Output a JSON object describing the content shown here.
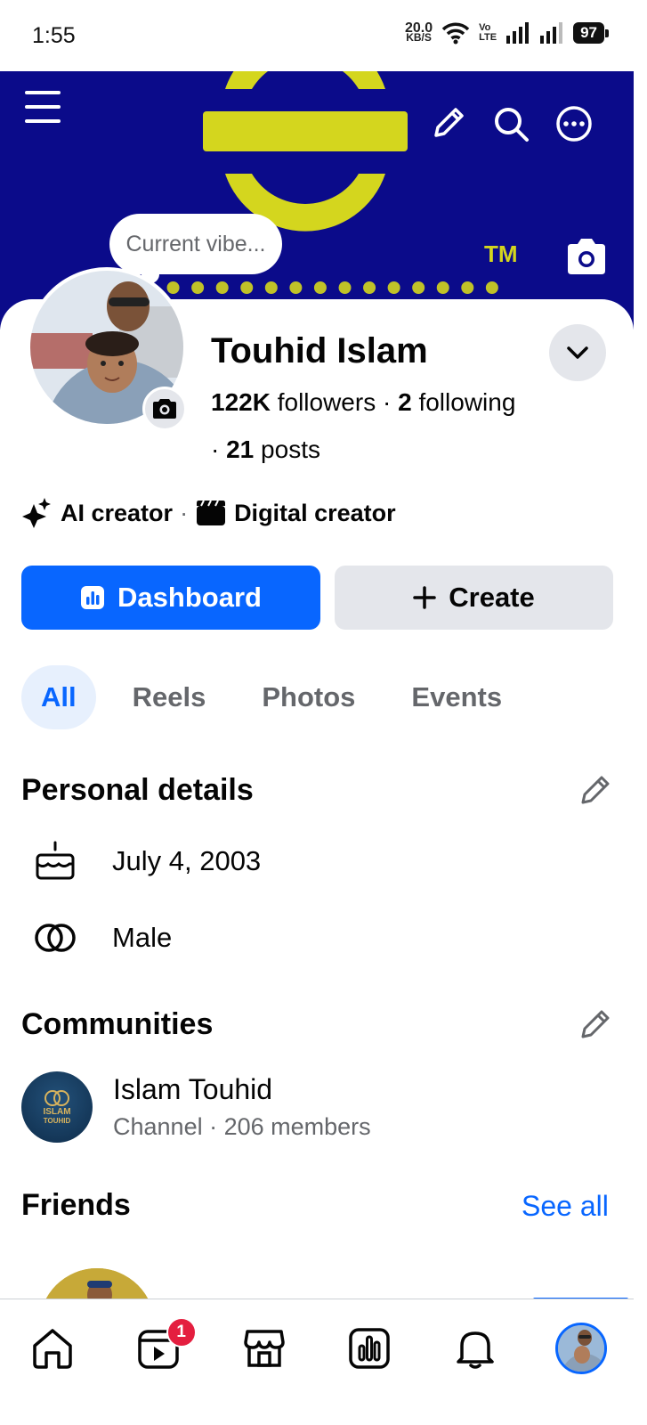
{
  "status_bar": {
    "time": "1:55",
    "net_speed_value": "20.0",
    "net_speed_unit": "KB/S",
    "volte_top": "Vo",
    "volte_bottom": "LTE",
    "battery": "97"
  },
  "cover": {
    "tm_mark": "TM"
  },
  "current_vibe": "Current vibe...",
  "profile": {
    "name": "Touhid Islam",
    "followers_count": "122K",
    "followers_label": "followers",
    "following_count": "2",
    "following_label": "following",
    "posts_count": "21",
    "posts_label": "posts"
  },
  "creator_tags": [
    "AI creator",
    "Digital creator"
  ],
  "actions": {
    "dashboard_label": "Dashboard",
    "create_label": "Create"
  },
  "tabs": [
    {
      "label": "All",
      "active": true
    },
    {
      "label": "Reels",
      "active": false
    },
    {
      "label": "Photos",
      "active": false
    },
    {
      "label": "Events",
      "active": false
    }
  ],
  "personal_details": {
    "title": "Personal details",
    "birthday": "July 4, 2003",
    "gender": "Male"
  },
  "communities": {
    "title": "Communities",
    "items": [
      {
        "name": "Islam Touhid",
        "meta": "Channel · 206 members",
        "logo_text_1": "ISLAM",
        "logo_text_2": "TOUHID"
      }
    ]
  },
  "friends": {
    "title": "Friends",
    "see_all": "See all"
  },
  "bottom_nav": {
    "reels_badge": "1"
  },
  "colors": {
    "accent": "#0866ff",
    "cover_bg": "#0b0b8a",
    "cover_logo": "#d4d61e",
    "badge": "#e41e3f"
  }
}
